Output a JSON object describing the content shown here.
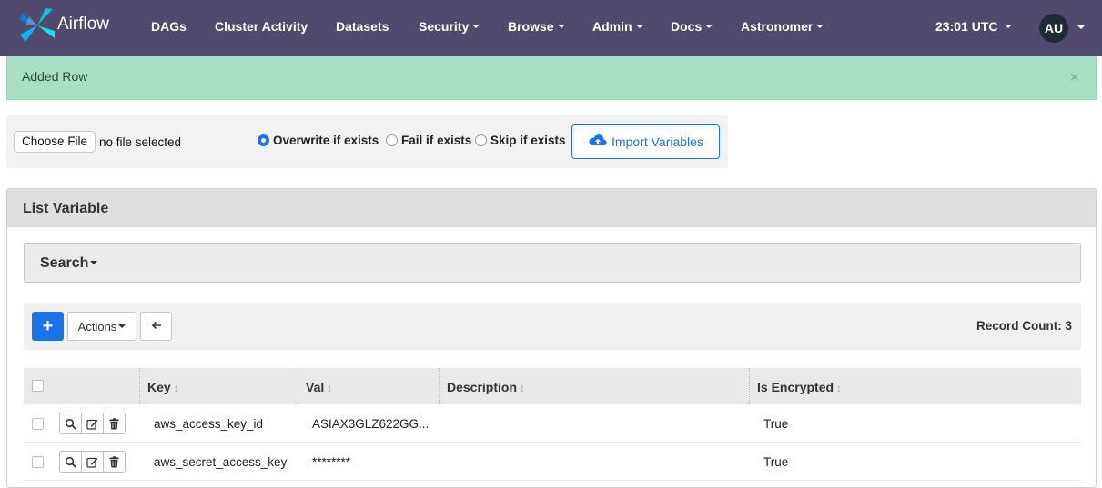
{
  "navbar": {
    "brand": "Airflow",
    "items": [
      {
        "label": "DAGs",
        "dropdown": false
      },
      {
        "label": "Cluster Activity",
        "dropdown": false
      },
      {
        "label": "Datasets",
        "dropdown": false
      },
      {
        "label": "Security",
        "dropdown": true
      },
      {
        "label": "Browse",
        "dropdown": true
      },
      {
        "label": "Admin",
        "dropdown": true
      },
      {
        "label": "Docs",
        "dropdown": true
      },
      {
        "label": "Astronomer",
        "dropdown": true
      }
    ],
    "clock": "23:01 UTC",
    "avatar_initials": "AU",
    "colors": {
      "background": "#51496e",
      "text": "#ffffff"
    }
  },
  "alert": {
    "message": "Added Row",
    "close_symbol": "×",
    "color": "#a7e1c4"
  },
  "import_form": {
    "choose_file_label": "Choose File",
    "file_status": "no file selected",
    "options": [
      {
        "label": "Overwrite if exists",
        "selected": true
      },
      {
        "label": "Fail if exists",
        "selected": false
      },
      {
        "label": "Skip if exists",
        "selected": false
      }
    ],
    "import_button_label": "Import Variables",
    "import_icon": "cloud-upload-icon"
  },
  "panel": {
    "title": "List Variable",
    "search_label": "Search",
    "toolbar": {
      "add_symbol": "+",
      "actions_label": "Actions",
      "back_icon": "arrow-left-icon",
      "record_count": "Record Count: 3"
    },
    "table": {
      "columns": [
        "Key",
        "Val",
        "Description",
        "Is Encrypted"
      ],
      "row_action_icons": [
        "search-icon",
        "edit-icon",
        "trash-icon"
      ],
      "rows": [
        {
          "key": "aws_access_key_id",
          "val": "ASIAX3GLZ622GG...",
          "description": "",
          "is_encrypted": "True"
        },
        {
          "key": "aws_secret_access_key",
          "val": "********",
          "description": "",
          "is_encrypted": "True"
        }
      ]
    },
    "accent_color": "#1a73e8"
  }
}
